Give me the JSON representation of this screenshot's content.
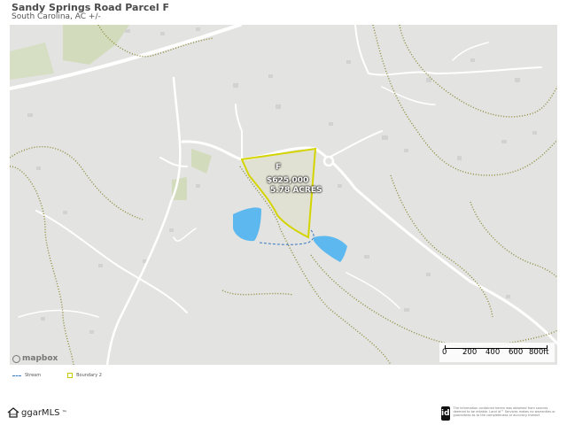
{
  "header": {
    "title": "Sandy Springs Road Parcel F",
    "subtitle": "South Carolina,  AC +/-"
  },
  "parcel": {
    "label": "F",
    "price": "$625,000",
    "acres": "5.78 ACRES"
  },
  "map": {
    "attribution": "mapbox",
    "scale_labels": [
      "0",
      "200",
      "400",
      "600",
      "800ft"
    ]
  },
  "legend": {
    "stream": "Stream",
    "boundary": "Boundary 2"
  },
  "footer": {
    "logo": "ggarMLS",
    "trademark": "™",
    "id_badge": "id",
    "disclaimer": "The information contained herein was obtained from sources deemed to be reliable. Land id™ Services makes no warranties or guarantees as to the completeness or accuracy thereof."
  },
  "colors": {
    "boundary": "#d4d400",
    "water": "#5cb8ee",
    "road": "#ffffff",
    "contour": "#8a8a3a",
    "land": "#e3e3e1",
    "park": "#cfdcb8"
  }
}
